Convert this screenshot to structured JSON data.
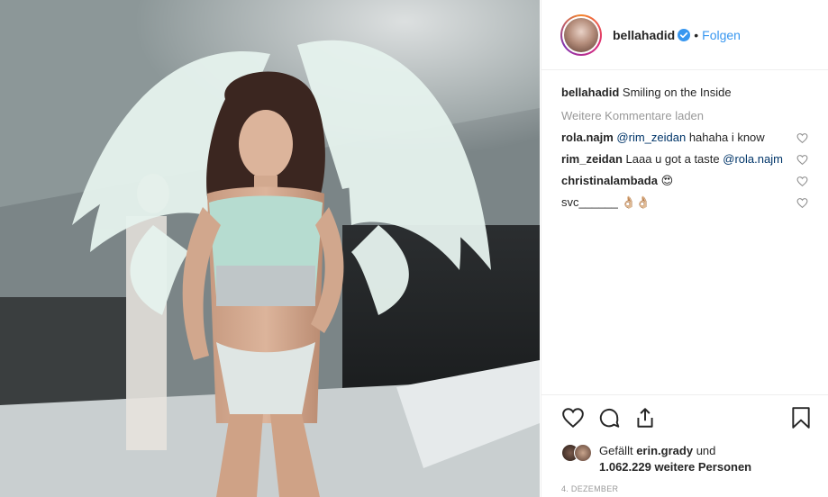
{
  "post": {
    "image_alt": "runway photo"
  },
  "header": {
    "username": "bellahadid",
    "separator": "•",
    "follow_label": "Folgen"
  },
  "caption": {
    "username": "bellahadid",
    "text": "Smiling on the Inside"
  },
  "load_more_label": "Weitere Kommentare laden",
  "comments": [
    {
      "username": "rola.najm",
      "mention": "@rim_zeidan",
      "text": "hahaha i know"
    },
    {
      "username": "rim_zeidan",
      "text": "Laaa u got a taste",
      "mention": "@rola.najm"
    },
    {
      "username": "christinalambada",
      "text": "😍"
    },
    {
      "username": "svc______",
      "text": "👌🏼👌🏼"
    }
  ],
  "likes": {
    "prefix": "Gefällt",
    "user": "erin.grady",
    "connector": "und",
    "count": "1.062.229",
    "suffix": "weitere Personen"
  },
  "date": "4. DEZEMBER",
  "icons": [
    "heart-icon",
    "comment-icon",
    "share-icon",
    "bookmark-icon",
    "verified-icon"
  ],
  "colors": {
    "link": "#3897f0",
    "mention": "#003569",
    "muted": "#999999"
  }
}
